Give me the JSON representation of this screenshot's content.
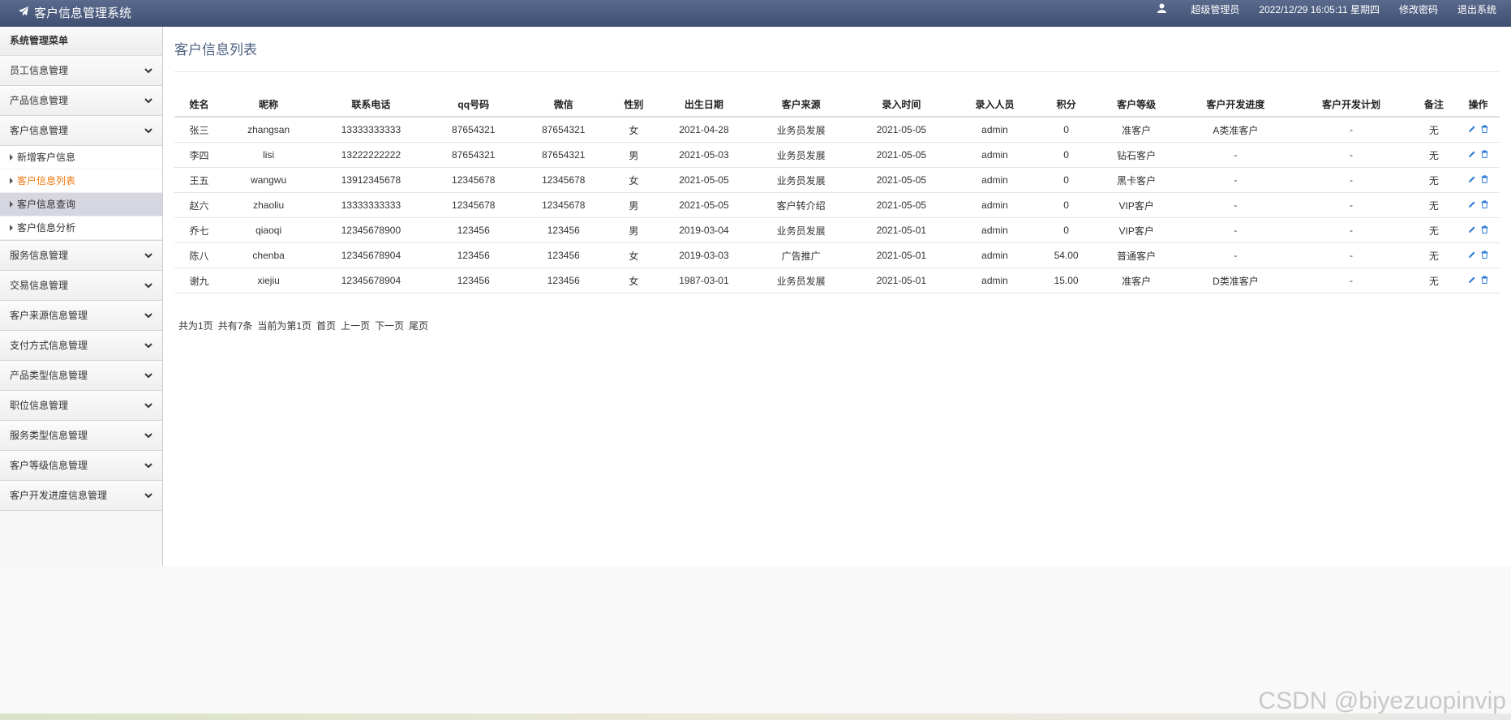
{
  "app": {
    "title": "客户信息管理系统"
  },
  "header": {
    "user": "超级管理员",
    "datetime": "2022/12/29 16:05:11 星期四",
    "change_password": "修改密码",
    "logout": "退出系统"
  },
  "sidebar": {
    "header": "系统管理菜单",
    "menus": [
      {
        "label": "员工信息管理"
      },
      {
        "label": "产品信息管理"
      },
      {
        "label": "客户信息管理"
      },
      {
        "label": "服务信息管理"
      },
      {
        "label": "交易信息管理"
      },
      {
        "label": "客户来源信息管理"
      },
      {
        "label": "支付方式信息管理"
      },
      {
        "label": "产品类型信息管理"
      },
      {
        "label": "职位信息管理"
      },
      {
        "label": "服务类型信息管理"
      },
      {
        "label": "客户等级信息管理"
      },
      {
        "label": "客户开发进度信息管理"
      }
    ],
    "customer_submenu": [
      {
        "label": "新增客户信息"
      },
      {
        "label": "客户信息列表"
      },
      {
        "label": "客户信息查询"
      },
      {
        "label": "客户信息分析"
      }
    ]
  },
  "main": {
    "title": "客户信息列表",
    "table": {
      "columns": [
        "姓名",
        "昵称",
        "联系电话",
        "qq号码",
        "微信",
        "性别",
        "出生日期",
        "客户来源",
        "录入时间",
        "录入人员",
        "积分",
        "客户等级",
        "客户开发进度",
        "客户开发计划",
        "备注",
        "操作"
      ],
      "rows": [
        [
          "张三",
          "zhangsan",
          "13333333333",
          "87654321",
          "87654321",
          "女",
          "2021-04-28",
          "业务员发展",
          "2021-05-05",
          "admin",
          "0",
          "准客户",
          "A类准客户",
          "-",
          "无"
        ],
        [
          "李四",
          "lisi",
          "13222222222",
          "87654321",
          "87654321",
          "男",
          "2021-05-03",
          "业务员发展",
          "2021-05-05",
          "admin",
          "0",
          "钻石客户",
          "-",
          "-",
          "无"
        ],
        [
          "王五",
          "wangwu",
          "13912345678",
          "12345678",
          "12345678",
          "女",
          "2021-05-05",
          "业务员发展",
          "2021-05-05",
          "admin",
          "0",
          "黑卡客户",
          "-",
          "-",
          "无"
        ],
        [
          "赵六",
          "zhaoliu",
          "13333333333",
          "12345678",
          "12345678",
          "男",
          "2021-05-05",
          "客户转介绍",
          "2021-05-05",
          "admin",
          "0",
          "VIP客户",
          "-",
          "-",
          "无"
        ],
        [
          "乔七",
          "qiaoqi",
          "12345678900",
          "123456",
          "123456",
          "男",
          "2019-03-04",
          "业务员发展",
          "2021-05-01",
          "admin",
          "0",
          "VIP客户",
          "-",
          "-",
          "无"
        ],
        [
          "陈八",
          "chenba",
          "12345678904",
          "123456",
          "123456",
          "女",
          "2019-03-03",
          "广告推广",
          "2021-05-01",
          "admin",
          "54.00",
          "普通客户",
          "-",
          "-",
          "无"
        ],
        [
          "谢九",
          "xiejiu",
          "12345678904",
          "123456",
          "123456",
          "女",
          "1987-03-01",
          "业务员发展",
          "2021-05-01",
          "admin",
          "15.00",
          "准客户",
          "D类准客户",
          "-",
          "无"
        ]
      ]
    },
    "pager": {
      "total_pages": "共为1页",
      "total_items": "共有7条",
      "current": "当前为第1页",
      "first": "首页",
      "prev": "上一页",
      "next": "下一页",
      "last": "尾页"
    }
  },
  "watermark": "CSDN @biyezuopinvip",
  "colors": {
    "header_bg": "#4a5a7e",
    "active_menu": "#f07a12",
    "title": "#4e6181",
    "icon": "#2b7bd6"
  },
  "icons": {
    "brand": "paper-plane-icon",
    "user": "user-icon",
    "menu_toggle": "chevron-down-icon",
    "edit": "pencil-icon",
    "delete": "trash-icon"
  }
}
